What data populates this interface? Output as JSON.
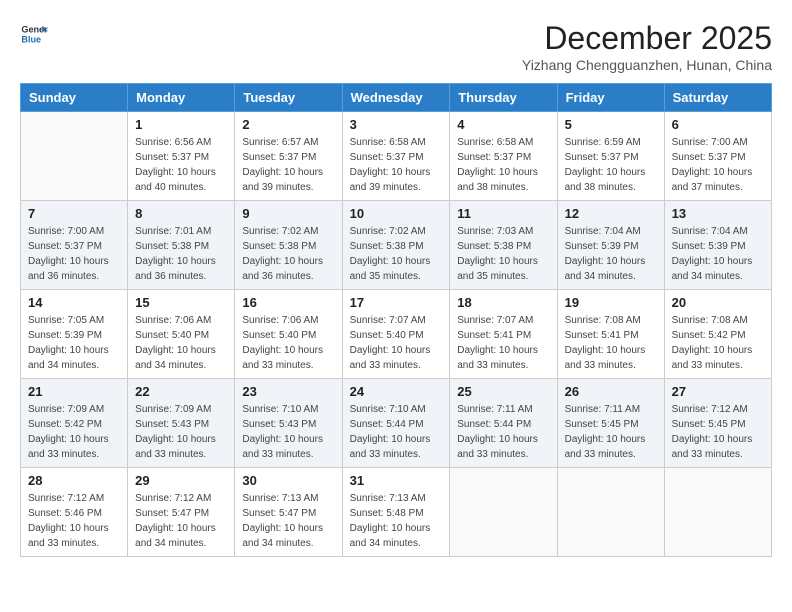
{
  "logo": {
    "line1": "General",
    "line2": "Blue"
  },
  "title": "December 2025",
  "location": "Yizhang Chengguanzhen, Hunan, China",
  "weekdays": [
    "Sunday",
    "Monday",
    "Tuesday",
    "Wednesday",
    "Thursday",
    "Friday",
    "Saturday"
  ],
  "weeks": [
    [
      {
        "day": "",
        "info": ""
      },
      {
        "day": "1",
        "info": "Sunrise: 6:56 AM\nSunset: 5:37 PM\nDaylight: 10 hours\nand 40 minutes."
      },
      {
        "day": "2",
        "info": "Sunrise: 6:57 AM\nSunset: 5:37 PM\nDaylight: 10 hours\nand 39 minutes."
      },
      {
        "day": "3",
        "info": "Sunrise: 6:58 AM\nSunset: 5:37 PM\nDaylight: 10 hours\nand 39 minutes."
      },
      {
        "day": "4",
        "info": "Sunrise: 6:58 AM\nSunset: 5:37 PM\nDaylight: 10 hours\nand 38 minutes."
      },
      {
        "day": "5",
        "info": "Sunrise: 6:59 AM\nSunset: 5:37 PM\nDaylight: 10 hours\nand 38 minutes."
      },
      {
        "day": "6",
        "info": "Sunrise: 7:00 AM\nSunset: 5:37 PM\nDaylight: 10 hours\nand 37 minutes."
      }
    ],
    [
      {
        "day": "7",
        "info": "Sunrise: 7:00 AM\nSunset: 5:37 PM\nDaylight: 10 hours\nand 36 minutes."
      },
      {
        "day": "8",
        "info": "Sunrise: 7:01 AM\nSunset: 5:38 PM\nDaylight: 10 hours\nand 36 minutes."
      },
      {
        "day": "9",
        "info": "Sunrise: 7:02 AM\nSunset: 5:38 PM\nDaylight: 10 hours\nand 36 minutes."
      },
      {
        "day": "10",
        "info": "Sunrise: 7:02 AM\nSunset: 5:38 PM\nDaylight: 10 hours\nand 35 minutes."
      },
      {
        "day": "11",
        "info": "Sunrise: 7:03 AM\nSunset: 5:38 PM\nDaylight: 10 hours\nand 35 minutes."
      },
      {
        "day": "12",
        "info": "Sunrise: 7:04 AM\nSunset: 5:39 PM\nDaylight: 10 hours\nand 34 minutes."
      },
      {
        "day": "13",
        "info": "Sunrise: 7:04 AM\nSunset: 5:39 PM\nDaylight: 10 hours\nand 34 minutes."
      }
    ],
    [
      {
        "day": "14",
        "info": "Sunrise: 7:05 AM\nSunset: 5:39 PM\nDaylight: 10 hours\nand 34 minutes."
      },
      {
        "day": "15",
        "info": "Sunrise: 7:06 AM\nSunset: 5:40 PM\nDaylight: 10 hours\nand 34 minutes."
      },
      {
        "day": "16",
        "info": "Sunrise: 7:06 AM\nSunset: 5:40 PM\nDaylight: 10 hours\nand 33 minutes."
      },
      {
        "day": "17",
        "info": "Sunrise: 7:07 AM\nSunset: 5:40 PM\nDaylight: 10 hours\nand 33 minutes."
      },
      {
        "day": "18",
        "info": "Sunrise: 7:07 AM\nSunset: 5:41 PM\nDaylight: 10 hours\nand 33 minutes."
      },
      {
        "day": "19",
        "info": "Sunrise: 7:08 AM\nSunset: 5:41 PM\nDaylight: 10 hours\nand 33 minutes."
      },
      {
        "day": "20",
        "info": "Sunrise: 7:08 AM\nSunset: 5:42 PM\nDaylight: 10 hours\nand 33 minutes."
      }
    ],
    [
      {
        "day": "21",
        "info": "Sunrise: 7:09 AM\nSunset: 5:42 PM\nDaylight: 10 hours\nand 33 minutes."
      },
      {
        "day": "22",
        "info": "Sunrise: 7:09 AM\nSunset: 5:43 PM\nDaylight: 10 hours\nand 33 minutes."
      },
      {
        "day": "23",
        "info": "Sunrise: 7:10 AM\nSunset: 5:43 PM\nDaylight: 10 hours\nand 33 minutes."
      },
      {
        "day": "24",
        "info": "Sunrise: 7:10 AM\nSunset: 5:44 PM\nDaylight: 10 hours\nand 33 minutes."
      },
      {
        "day": "25",
        "info": "Sunrise: 7:11 AM\nSunset: 5:44 PM\nDaylight: 10 hours\nand 33 minutes."
      },
      {
        "day": "26",
        "info": "Sunrise: 7:11 AM\nSunset: 5:45 PM\nDaylight: 10 hours\nand 33 minutes."
      },
      {
        "day": "27",
        "info": "Sunrise: 7:12 AM\nSunset: 5:45 PM\nDaylight: 10 hours\nand 33 minutes."
      }
    ],
    [
      {
        "day": "28",
        "info": "Sunrise: 7:12 AM\nSunset: 5:46 PM\nDaylight: 10 hours\nand 33 minutes."
      },
      {
        "day": "29",
        "info": "Sunrise: 7:12 AM\nSunset: 5:47 PM\nDaylight: 10 hours\nand 34 minutes."
      },
      {
        "day": "30",
        "info": "Sunrise: 7:13 AM\nSunset: 5:47 PM\nDaylight: 10 hours\nand 34 minutes."
      },
      {
        "day": "31",
        "info": "Sunrise: 7:13 AM\nSunset: 5:48 PM\nDaylight: 10 hours\nand 34 minutes."
      },
      {
        "day": "",
        "info": ""
      },
      {
        "day": "",
        "info": ""
      },
      {
        "day": "",
        "info": ""
      }
    ]
  ]
}
